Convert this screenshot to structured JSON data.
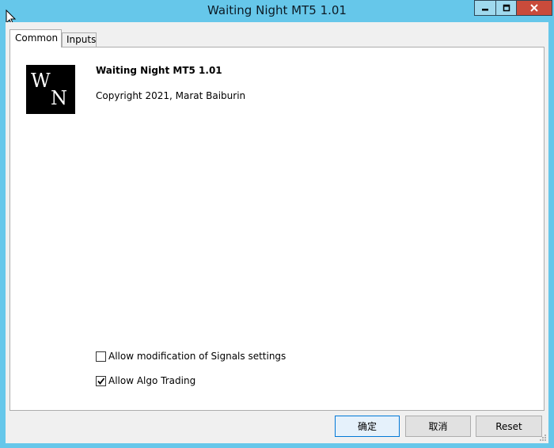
{
  "window": {
    "title": "Waiting Night MT5 1.01"
  },
  "tabs": [
    {
      "label": "Common",
      "active": true
    },
    {
      "label": "Inputs",
      "active": false
    }
  ],
  "program": {
    "logo_letter_top": "W",
    "logo_letter_bottom": "N",
    "name": "Waiting Night MT5 1.01",
    "copyright": "Copyright 2021, Marat Baiburin"
  },
  "options": [
    {
      "label": "Allow modification of Signals settings",
      "checked": false
    },
    {
      "label": "Allow Algo Trading",
      "checked": true
    }
  ],
  "buttons": {
    "ok": "确定",
    "cancel": "取消",
    "reset": "Reset"
  },
  "colors": {
    "titlebar": "#66c7ea",
    "close_button": "#c94b3b"
  }
}
